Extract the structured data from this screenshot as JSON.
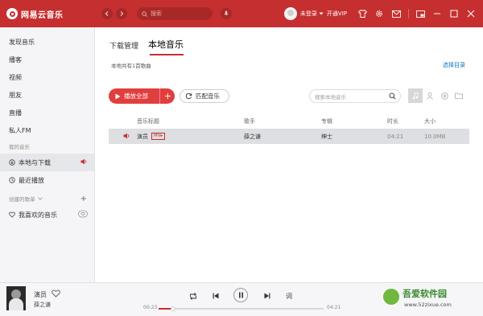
{
  "app": {
    "title": "网易云音乐",
    "search_placeholder": "搜索",
    "user_name": "未登录",
    "vip_label": "开通VIP"
  },
  "sidebar": {
    "items": [
      {
        "label": "发现音乐"
      },
      {
        "label": "播客"
      },
      {
        "label": "视频"
      },
      {
        "label": "朋友"
      },
      {
        "label": "直播"
      },
      {
        "label": "私人FM"
      }
    ],
    "section_my": "我的音乐",
    "my_items": [
      {
        "label": "本地与下载",
        "active": true
      },
      {
        "label": "最近播放"
      }
    ],
    "section_created": "创建的歌单",
    "playlist_favorite": "我喜欢的音乐"
  },
  "main": {
    "tabs": [
      {
        "label": "下载管理",
        "active": false
      },
      {
        "label": "本地音乐",
        "active": true
      }
    ],
    "count_text": "本地共有1首歌曲",
    "select_dir": "选择目录",
    "play_all": "播放全部",
    "play_all_plus": "+",
    "match_music": "匹配音乐",
    "search_local_placeholder": "搜索本地音乐"
  },
  "table": {
    "headers": {
      "title": "音乐标题",
      "artist": "歌手",
      "album": "专辑",
      "duration": "时长",
      "size": "大小"
    },
    "rows": [
      {
        "title": "演员",
        "badge": "MV",
        "artist": "薛之谦",
        "album": "绅士",
        "duration": "04:21",
        "size": "10.0MB"
      }
    ]
  },
  "player": {
    "song": "演员",
    "artist": "薛之谦",
    "time_current": "00:23",
    "time_total": "04:21",
    "progress": 0.09,
    "lyric_button": "词"
  },
  "watermark": {
    "name": "吾爱软件园",
    "url": "www.52zixue.com"
  },
  "colors": {
    "brand_red": "#c62f2f",
    "play_button": "#e13e3e",
    "link_blue": "#0c73c2"
  }
}
